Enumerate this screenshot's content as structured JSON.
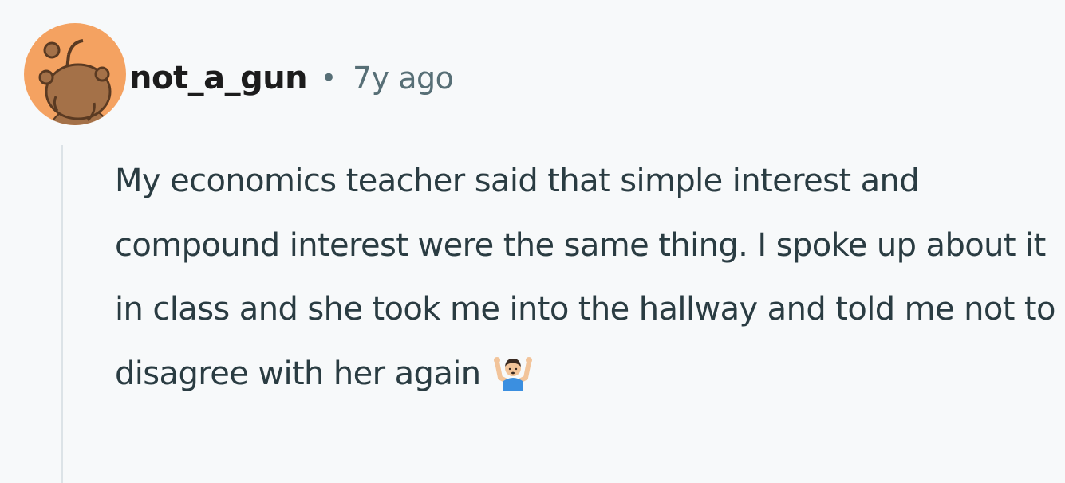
{
  "comment": {
    "username": "not_a_gun",
    "separator": "•",
    "timestamp": "7y ago",
    "body": "My economics teacher said that simple interest and compound interest were the same thing. I spoke up about it in class and she took me into the hallway and told me not to disagree with her again",
    "emoji": "person-shrugging-emoji"
  },
  "colors": {
    "avatar_background": "#f4a261",
    "thread_line": "#dce3e7",
    "page_background": "#f7f9fa"
  }
}
